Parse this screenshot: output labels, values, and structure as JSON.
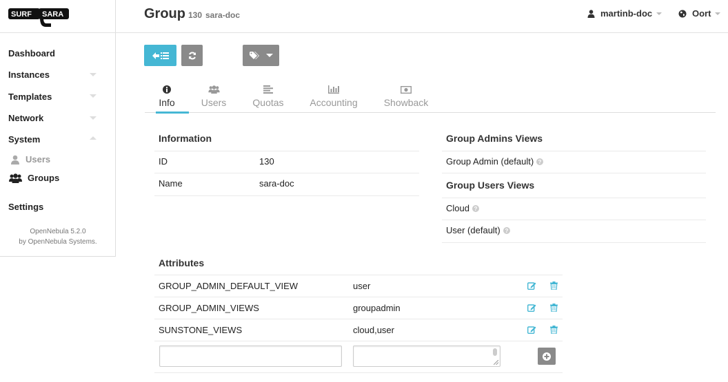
{
  "brand": {
    "logo_left": "SURF",
    "logo_right": "SARA"
  },
  "sidebar": {
    "items": [
      {
        "label": "Dashboard"
      },
      {
        "label": "Instances"
      },
      {
        "label": "Templates"
      },
      {
        "label": "Network"
      },
      {
        "label": "System"
      },
      {
        "label": "Settings"
      }
    ],
    "sub_items": [
      {
        "label": "Users",
        "icon": "user-icon"
      },
      {
        "label": "Groups",
        "icon": "users-icon"
      }
    ],
    "footer": {
      "version": "OpenNebula 5.2.0",
      "by": "by OpenNebula Systems."
    }
  },
  "header": {
    "title": "Group",
    "group_id": "130",
    "group_name": "sara-doc",
    "user": "martinb-doc",
    "zone": "Oort"
  },
  "tabs": [
    {
      "label": "Info",
      "icon": "info-icon"
    },
    {
      "label": "Users",
      "icon": "users-icon"
    },
    {
      "label": "Quotas",
      "icon": "quotas-icon"
    },
    {
      "label": "Accounting",
      "icon": "chart-icon"
    },
    {
      "label": "Showback",
      "icon": "money-icon"
    }
  ],
  "information": {
    "title": "Information",
    "rows": [
      {
        "key": "ID",
        "value": "130"
      },
      {
        "key": "Name",
        "value": "sara-doc"
      }
    ]
  },
  "admin_views": {
    "title": "Group Admins Views",
    "items": [
      {
        "label": "Group Admin (default)"
      }
    ]
  },
  "user_views": {
    "title": "Group Users Views",
    "items": [
      {
        "label": "Cloud"
      },
      {
        "label": "User (default)"
      }
    ]
  },
  "attributes": {
    "title": "Attributes",
    "rows": [
      {
        "key": "GROUP_ADMIN_DEFAULT_VIEW",
        "value": "user"
      },
      {
        "key": "GROUP_ADMIN_VIEWS",
        "value": "groupadmin"
      },
      {
        "key": "SUNSTONE_VIEWS",
        "value": "cloud,user"
      }
    ],
    "new_key_value": "",
    "new_value_value": ""
  },
  "colors": {
    "accent": "#45b7d4",
    "button_gray": "#8a8a8a"
  }
}
